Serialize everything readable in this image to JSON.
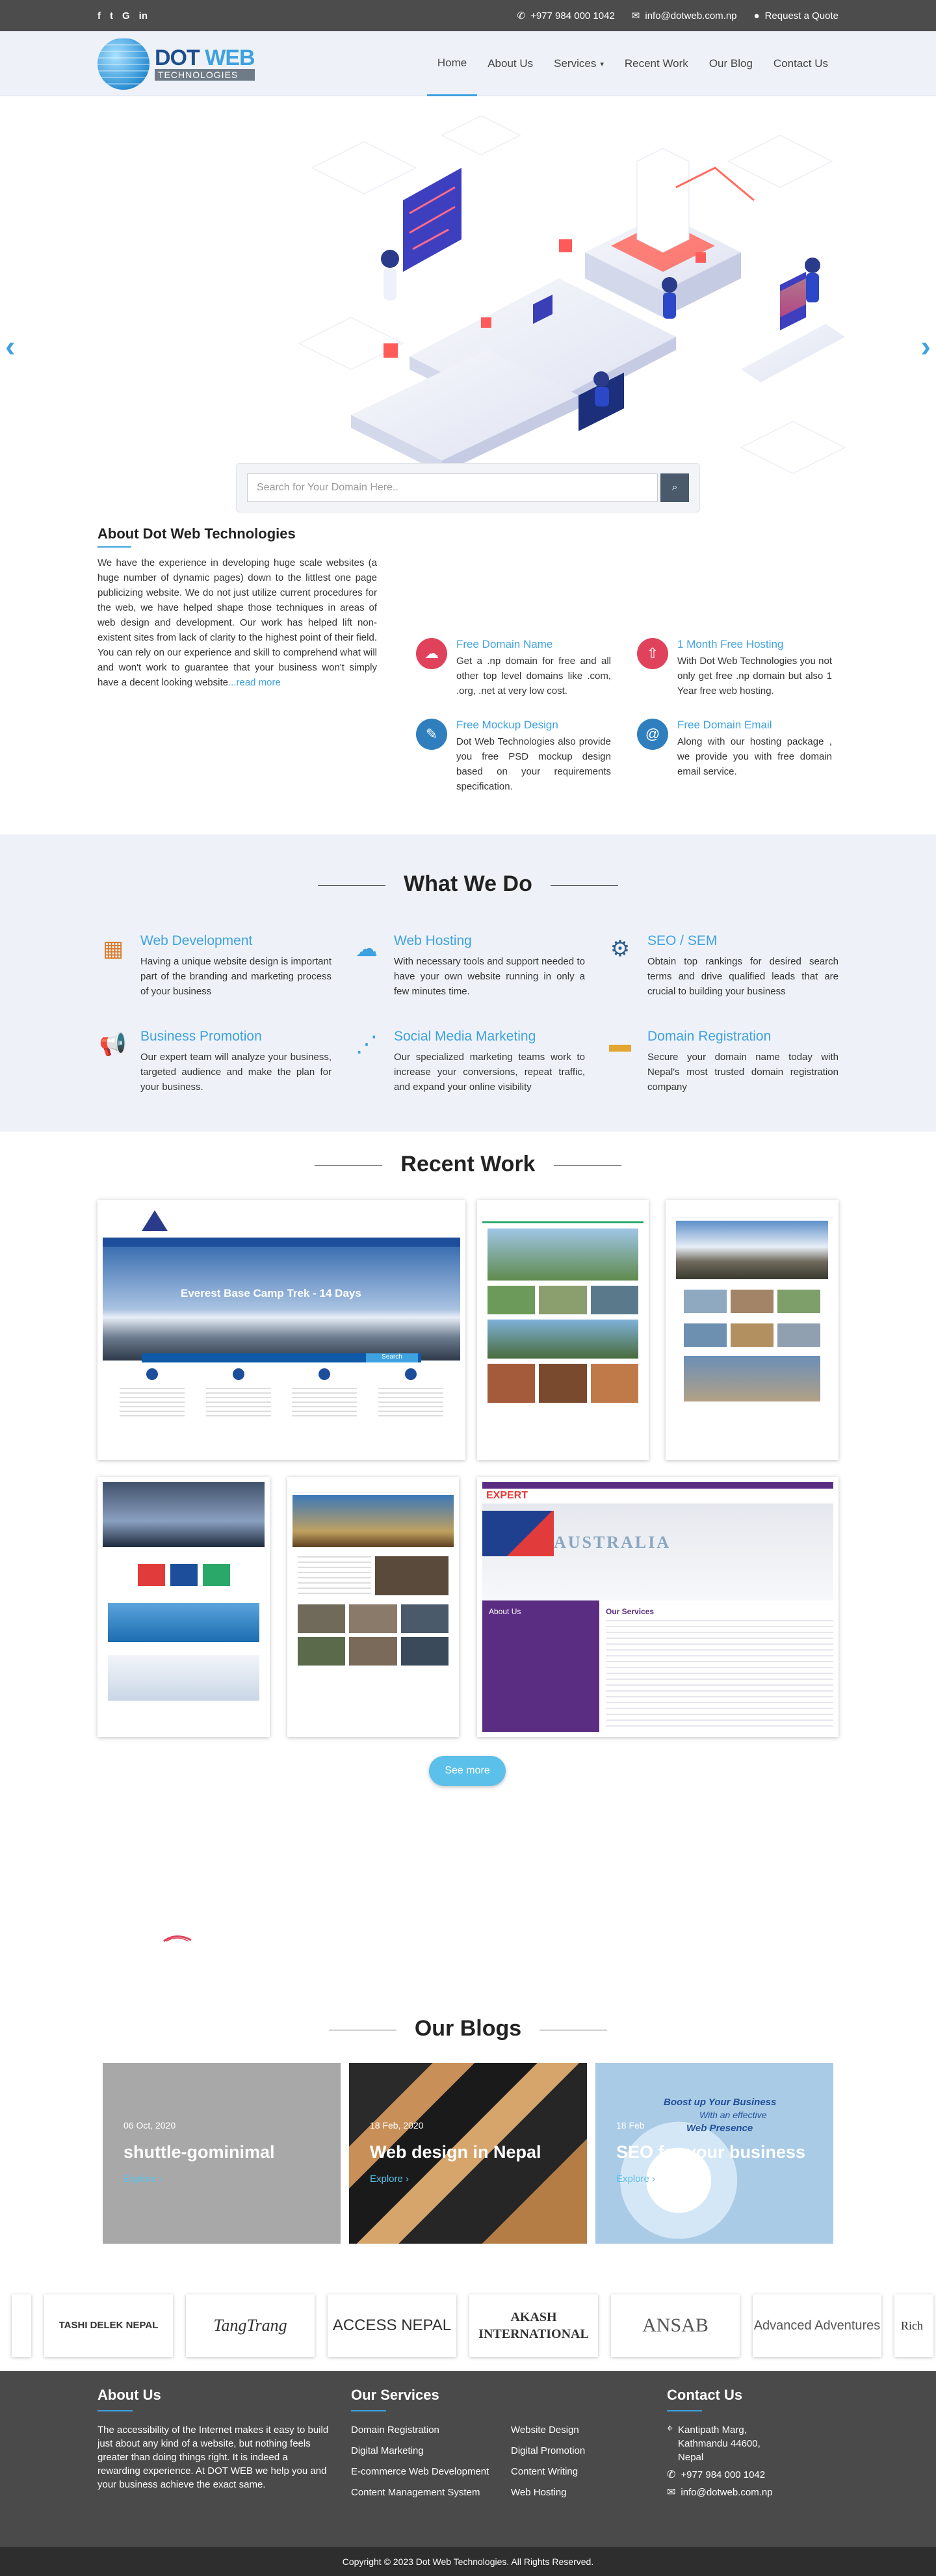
{
  "topbar": {
    "social": [
      "f",
      "t",
      "G",
      "in"
    ],
    "phone": "+977 984 000 1042",
    "email": "info@dotweb.com.np",
    "quote": "Request a Quote"
  },
  "brand": {
    "line1a": "DOT",
    "line1b": "WEB",
    "line2": "TECHNOLOGIES"
  },
  "nav": [
    "Home",
    "About Us",
    "Services",
    "Recent Work",
    "Our Blog",
    "Contact Us"
  ],
  "hero": {
    "prev": "‹",
    "next": "›"
  },
  "search": {
    "placeholder": "Search for Your Domain Here.."
  },
  "about": {
    "title": "About Dot Web Technologies",
    "text": "We have the experience in developing huge scale websites (a huge number of dynamic pages) down to the littlest one page publicizing website. We do not just utilize current procedures for the web, we have helped shape those techniques in areas of web design and development. Our work has helped lift non-existent sites from lack of clarity to the highest point of their field. You can rely on our experience and skill to comprehend what will and won't work to guarantee that your business won't simply have a decent looking website",
    "more": "...read more"
  },
  "features": [
    {
      "title": "Free Domain Name",
      "text": "Get a .np domain for free and all other top level domains like .com, .org, .net at very low cost.",
      "color": "#e0425b"
    },
    {
      "title": "1 Month Free Hosting",
      "text": "With Dot Web Technologies you not only get free .np domain but also 1 Year free web hosting.",
      "color": "#e0425b"
    },
    {
      "title": "Free Mockup Design",
      "text": "Dot Web Technologies also provide you free PSD mockup design based on your requirements specification.",
      "color": "#2f7fbf"
    },
    {
      "title": "Free Domain Email",
      "text": "Along with our hosting package , we provide you with free domain email service.",
      "color": "#2f7fbf"
    }
  ],
  "whatwedo": {
    "title": "What We Do",
    "items": [
      {
        "title": "Web Development",
        "text": "Having a unique website design is important part of the branding and marketing process of your business"
      },
      {
        "title": "Web Hosting",
        "text": "With necessary tools and support needed to have your own website running in only a few minutes time."
      },
      {
        "title": "SEO / SEM",
        "text": "Obtain top rankings for desired search terms and drive qualified leads that are crucial to building your business"
      },
      {
        "title": "Business Promotion",
        "text": "Our expert team will analyze your business, targeted audience and make the plan for your business."
      },
      {
        "title": "Social Media Marketing",
        "text": "Our specialized marketing teams work to increase your conversions, repeat traffic, and expand your online visibility"
      },
      {
        "title": "Domain Registration",
        "text": "Secure your domain name today with Nepal's most trusted domain registration company"
      }
    ]
  },
  "recentwork": {
    "title": "Recent Work",
    "shot1": {
      "heading": "Everest Base Camp Trek - 14 Days",
      "button": "Search"
    },
    "shot6": {
      "banner": "EXPERT",
      "headline": "AUSTRALIA",
      "about": "About Us",
      "services": "Our Services"
    },
    "seemore": "See more"
  },
  "blogs": {
    "title": "Our Blogs",
    "items": [
      {
        "date": "06 Oct, 2020",
        "title": "shuttle-gominimal",
        "link": "Explore"
      },
      {
        "date": "18 Feb, 2020",
        "title": "Web design in Nepal",
        "link": "Explore"
      },
      {
        "date": "18 Feb",
        "title": "SEO for your business",
        "link": "Explore"
      }
    ],
    "seo_promo": {
      "line1": "Boost up Your Business",
      "line2": "With an effective",
      "line3": "Web Presence"
    }
  },
  "clients": [
    "TASHI DELEK NEPAL",
    "TangTrang",
    "ACCESS NEPAL",
    "AKASH INTERNATIONAL",
    "ANSAB",
    "Advanced Adventures",
    "Rich"
  ],
  "footer": {
    "about_title": "About Us",
    "about_text": "The accessibility of the Internet makes it easy to build just about any kind of a website, but nothing feels greater than doing things right. It is indeed a rewarding experience. At DOT WEB we help you and your business achieve the exact same.",
    "services_title": "Our Services",
    "services_col1": [
      "Domain Registration",
      "Digital Marketing",
      "E-commerce Web Development",
      "Content Management System"
    ],
    "services_col2": [
      "Website Design",
      "Digital Promotion",
      "Content Writing",
      "Web Hosting"
    ],
    "contact_title": "Contact Us",
    "address": "Kantipath Marg, Kathmandu 44600, Nepal",
    "phone": "+977 984 000 1042",
    "email": "info@dotweb.com.np"
  },
  "copyright": "Copyright © 2023 Dot Web Technologies. All Rights Reserved.",
  "colors": {
    "accent": "#3ea1e0",
    "topbar": "#4c4c4c",
    "footer": "#4a4a4a"
  }
}
